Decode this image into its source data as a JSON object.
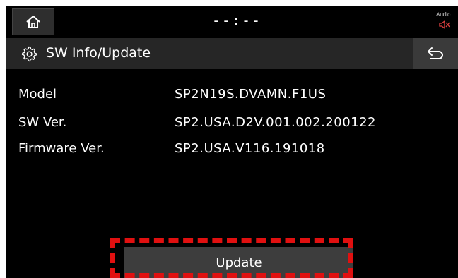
{
  "statusbar": {
    "clock": "--:--",
    "audio_label": "Audio",
    "home_icon": "home-icon",
    "mute_icon": "speaker-mute-icon"
  },
  "header": {
    "title": "SW Info/Update",
    "settings_icon": "gear-icon",
    "back_icon": "back-arrow-icon"
  },
  "info": {
    "rows": [
      {
        "label": "Model",
        "value": "SP2N19S.DVAMN.F1US"
      },
      {
        "label": "SW Ver.",
        "value": "SP2.USA.D2V.001.002.200122"
      },
      {
        "label": "Firmware Ver.",
        "value": "SP2.USA.V116.191018"
      }
    ]
  },
  "actions": {
    "update_label": "Update"
  },
  "colors": {
    "background": "#000000",
    "titlebar": "#262626",
    "button": "#3d3d3d",
    "highlight": "#e01010",
    "text": "#ffffff"
  }
}
